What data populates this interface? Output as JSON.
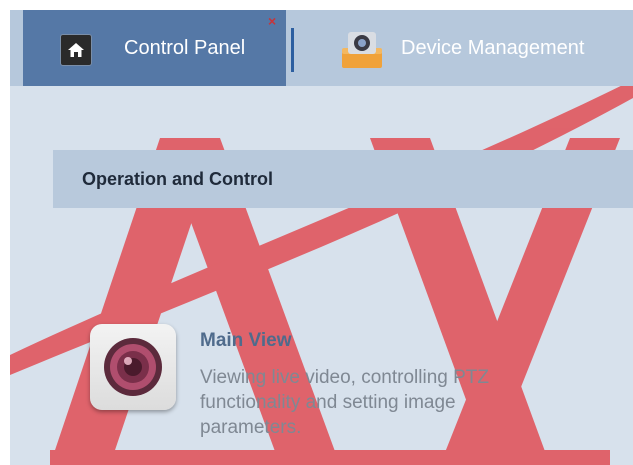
{
  "tabs": {
    "control_panel": {
      "label": "Control Panel"
    },
    "device_management": {
      "label": "Device Management"
    }
  },
  "section": {
    "title": "Operation and Control"
  },
  "items": [
    {
      "title": "Main View",
      "description": "Viewing live video, controlling PTZ functionality and setting image parameters."
    }
  ],
  "icons": {
    "home": "home-icon",
    "close": "close-icon",
    "device": "device-management-icon",
    "camera": "camera-lens-icon"
  },
  "colors": {
    "background": "#d7e1ec",
    "active_tab": "#5578a6",
    "tab_bar": "#b6c8dc",
    "section_header": "#b8c9dc",
    "watermark": "#e0353a",
    "item_title": "#4f6b8c",
    "item_text": "#7f8893"
  }
}
